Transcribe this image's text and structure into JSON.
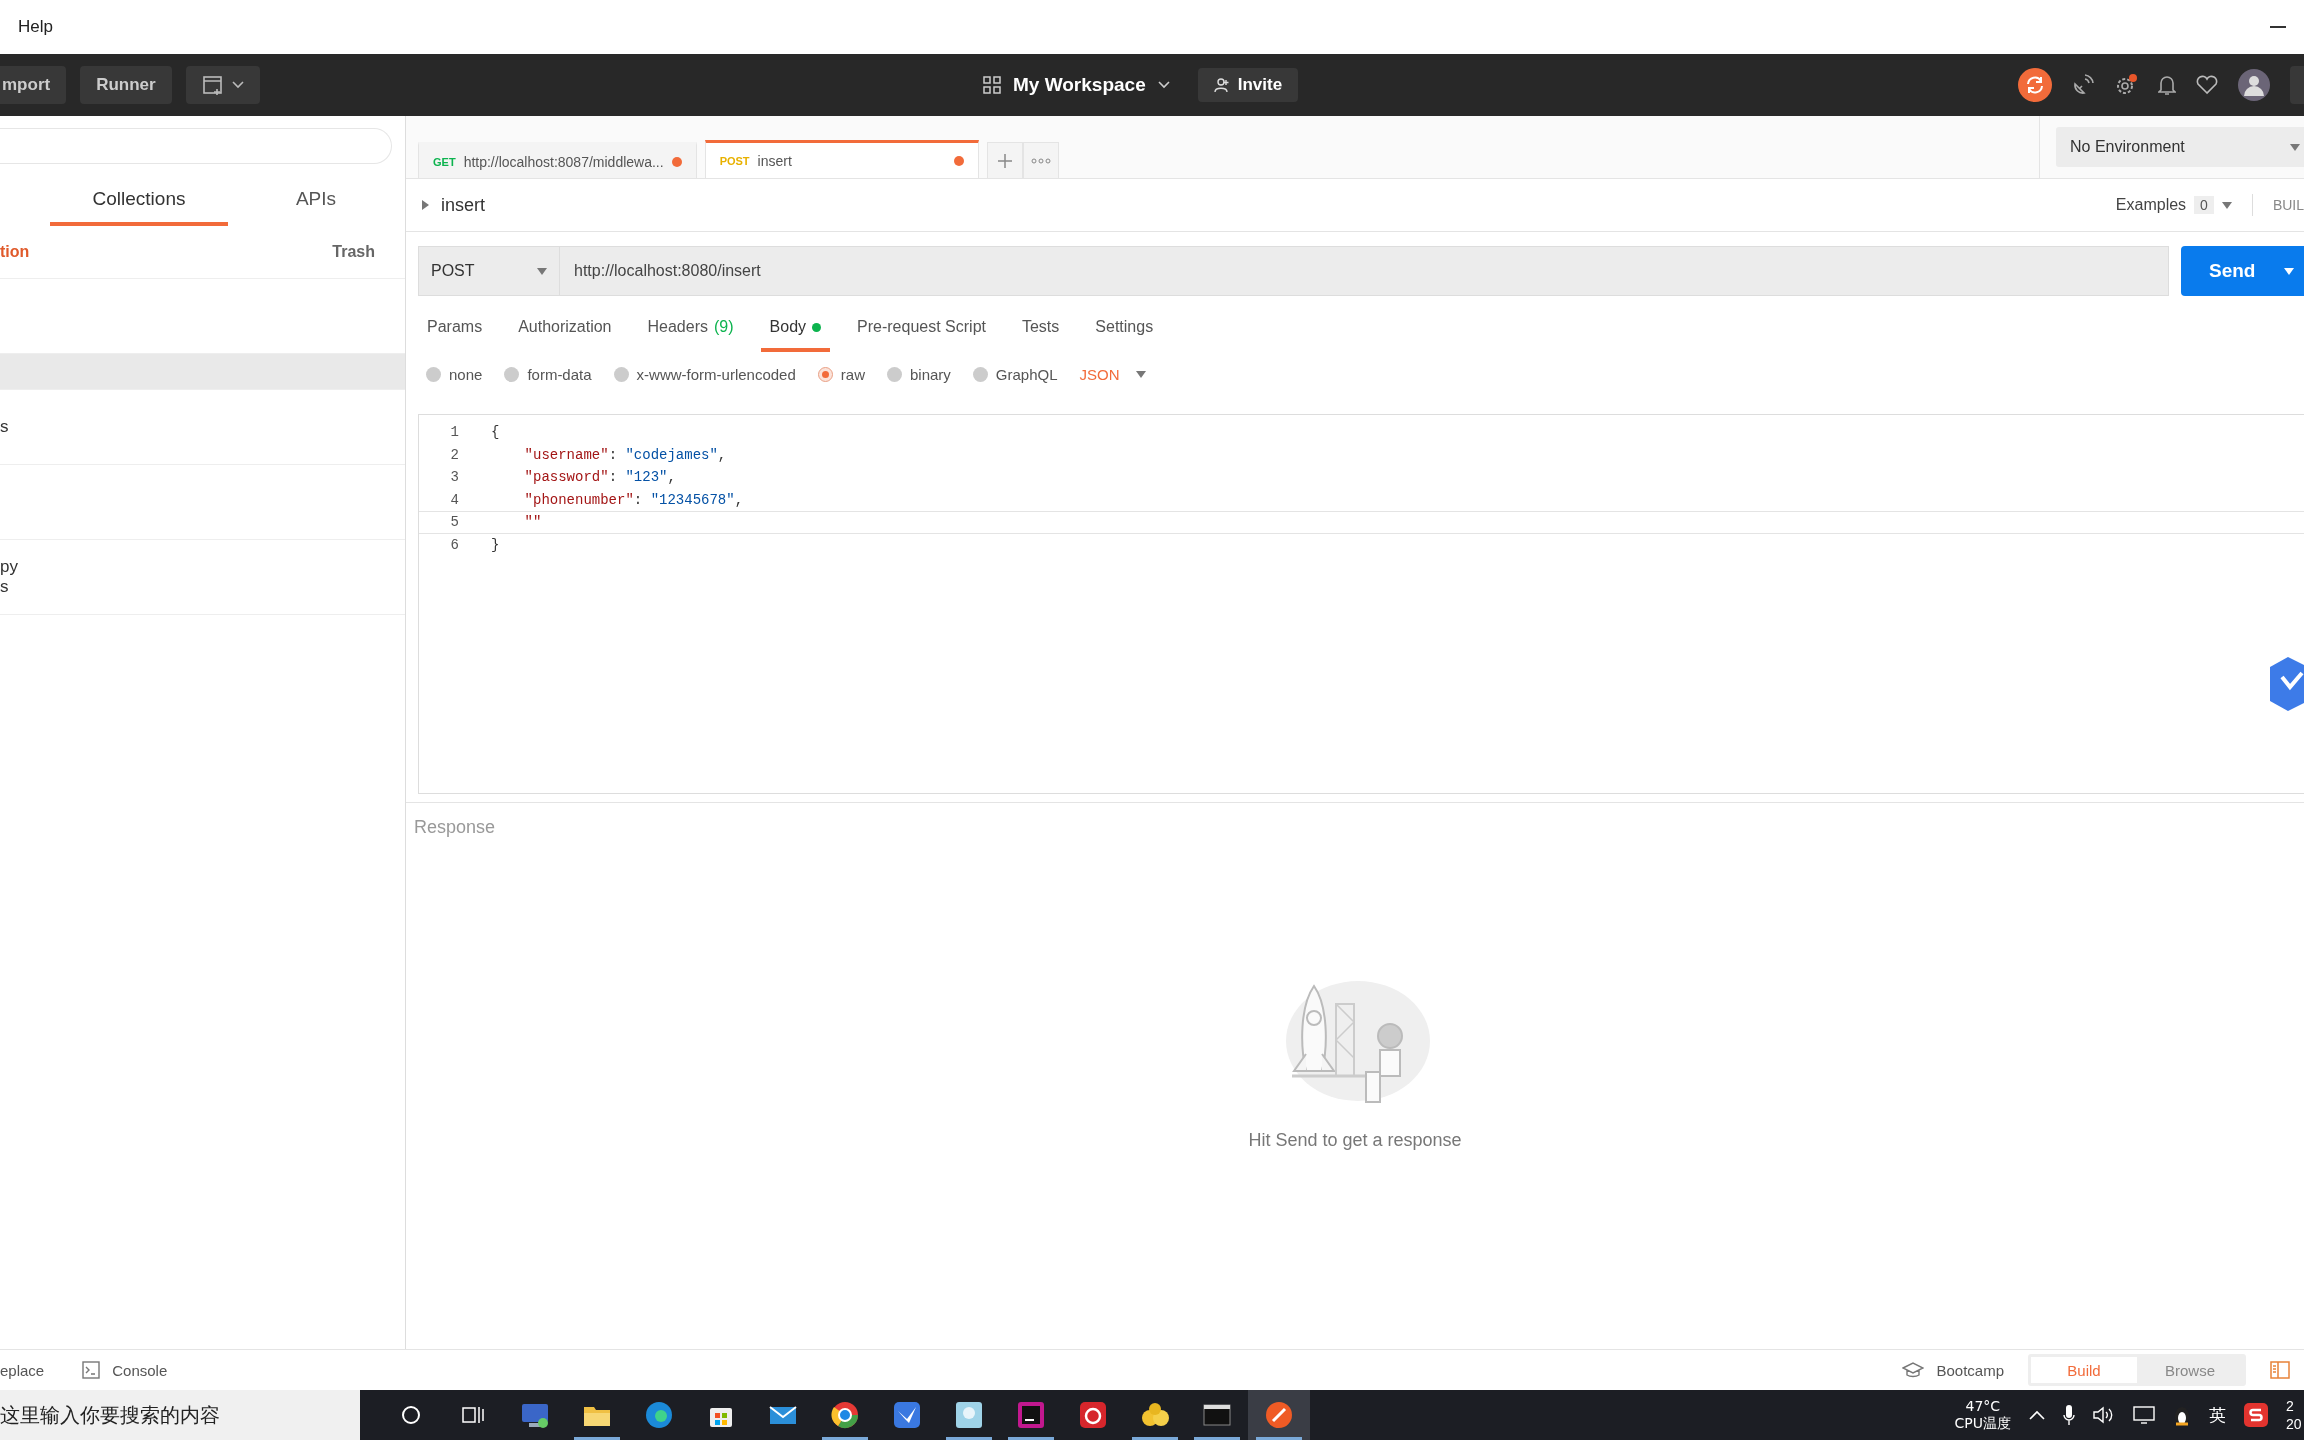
{
  "menu": {
    "items": [
      "Help"
    ]
  },
  "header": {
    "buttons": [
      "mport",
      "Runner"
    ],
    "workspace": "My Workspace",
    "invite": "Invite"
  },
  "sidebar": {
    "tabs": [
      {
        "label": "Collections",
        "selected": true
      },
      {
        "label": "APIs",
        "selected": false
      }
    ],
    "new_link": "tion",
    "trash": "Trash",
    "items": [
      {
        "selected": false
      },
      {
        "selected": true
      },
      {
        "selected": false,
        "lines": [
          "s"
        ]
      },
      {
        "selected": false
      },
      {
        "selected": false,
        "lines": [
          "py",
          "s"
        ]
      }
    ]
  },
  "request_tabs": [
    {
      "method": "GET",
      "color": "#0cb34e",
      "label": "http://localhost:8087/middlewa...",
      "unsaved": true,
      "selected": false
    },
    {
      "method": "POST",
      "color": "#e8b100",
      "label": "insert",
      "unsaved": true,
      "selected": true
    }
  ],
  "environment": "No Environment",
  "breadcrumb": "insert",
  "examples": {
    "label": "Examples",
    "count": "0"
  },
  "build_label": "BUIL",
  "request": {
    "method": "POST",
    "url": "http://localhost:8080/insert",
    "send": "Send"
  },
  "section_tabs": [
    {
      "label": "Params",
      "selected": false
    },
    {
      "label": "Authorization",
      "selected": false
    },
    {
      "label": "Headers",
      "count": "(9)",
      "selected": false
    },
    {
      "label": "Body",
      "dot": true,
      "selected": true
    },
    {
      "label": "Pre-request Script",
      "selected": false
    },
    {
      "label": "Tests",
      "selected": false
    },
    {
      "label": "Settings",
      "selected": false
    }
  ],
  "body_modes": [
    {
      "label": "none",
      "selected": false
    },
    {
      "label": "form-data",
      "selected": false
    },
    {
      "label": "x-www-form-urlencoded",
      "selected": false
    },
    {
      "label": "raw",
      "selected": true
    },
    {
      "label": "binary",
      "selected": false
    },
    {
      "label": "GraphQL",
      "selected": false
    }
  ],
  "body_format": "JSON",
  "editor": {
    "lines": [
      {
        "number": "1",
        "active": false,
        "tokens": [
          {
            "kind": "punct",
            "text": "{"
          }
        ]
      },
      {
        "number": "2",
        "active": false,
        "tokens": [
          {
            "kind": "key",
            "text": "    \"username\""
          },
          {
            "kind": "punct",
            "text": ": "
          },
          {
            "kind": "string",
            "text": "\"codejames\""
          },
          {
            "kind": "punct",
            "text": ","
          }
        ]
      },
      {
        "number": "3",
        "active": false,
        "tokens": [
          {
            "kind": "key",
            "text": "    \"password\""
          },
          {
            "kind": "punct",
            "text": ": "
          },
          {
            "kind": "string",
            "text": "\"123\""
          },
          {
            "kind": "punct",
            "text": ","
          }
        ]
      },
      {
        "number": "4",
        "active": false,
        "tokens": [
          {
            "kind": "key",
            "text": "    \"phonenumber\""
          },
          {
            "kind": "punct",
            "text": ": "
          },
          {
            "kind": "string",
            "text": "\"12345678\""
          },
          {
            "kind": "punct",
            "text": ","
          }
        ]
      },
      {
        "number": "5",
        "active": true,
        "tokens": [
          {
            "kind": "key",
            "text": "    \"\""
          }
        ]
      },
      {
        "number": "6",
        "active": false,
        "tokens": [
          {
            "kind": "punct",
            "text": "}"
          }
        ]
      }
    ]
  },
  "response": {
    "title": "Response",
    "empty_message": "Hit Send to get a response"
  },
  "status_bar": {
    "find": "eplace",
    "console": "Console",
    "bootcamp": "Bootcamp",
    "modes": [
      {
        "label": "Build",
        "selected": true
      },
      {
        "label": "Browse",
        "selected": false
      }
    ]
  },
  "taskbar": {
    "search_placeholder": "这里输入你要搜索的内容",
    "apps": [
      {
        "running": false,
        "selected": false
      },
      {
        "running": true,
        "selected": false
      },
      {
        "running": false,
        "selected": false
      },
      {
        "running": false,
        "selected": false
      },
      {
        "running": false,
        "selected": false
      },
      {
        "running": true,
        "selected": false
      },
      {
        "running": false,
        "selected": false
      },
      {
        "running": true,
        "selected": false
      },
      {
        "running": true,
        "selected": false
      },
      {
        "running": false,
        "selected": false
      },
      {
        "running": true,
        "selected": false
      },
      {
        "running": true,
        "selected": false
      },
      {
        "running": true,
        "selected": true
      }
    ],
    "temperature": "47°C",
    "temperature_label": "CPU温度",
    "ime": "英",
    "clock": [
      "2",
      "20"
    ]
  }
}
